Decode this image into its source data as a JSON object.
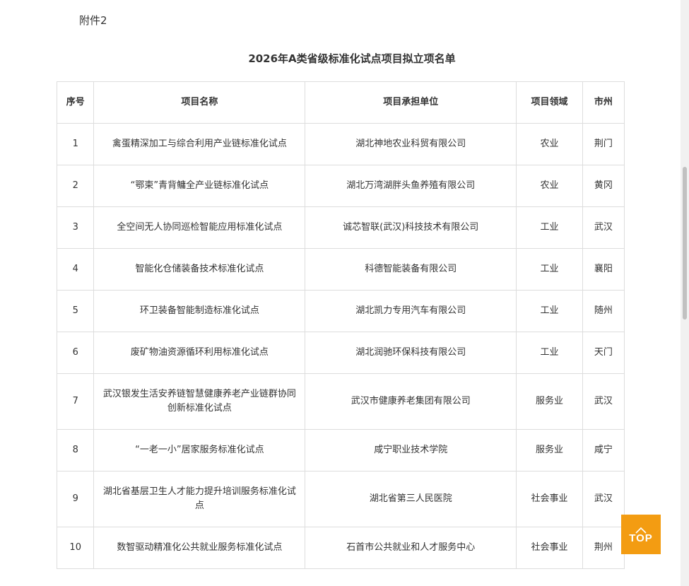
{
  "document": {
    "attachment_label": "附件2",
    "title": "2026年A类省级标准化试点项目拟立项名单"
  },
  "table": {
    "headers": {
      "seq": "序号",
      "name": "项目名称",
      "unit": "项目承担单位",
      "field": "项目领域",
      "city": "市州"
    },
    "rows": [
      {
        "seq": "1",
        "name": "禽蛋精深加工与综合利用产业链标准化试点",
        "unit": "湖北神地农业科贸有限公司",
        "field": "农业",
        "city": "荆门"
      },
      {
        "seq": "2",
        "name": "“鄂柬”青背鳙全产业链标准化试点",
        "unit": "湖北万湾湖胖头鱼养殖有限公司",
        "field": "农业",
        "city": "黄冈"
      },
      {
        "seq": "3",
        "name": "全空间无人协同巡检智能应用标准化试点",
        "unit": "诚芯智联(武汉)科技技术有限公司",
        "field": "工业",
        "city": "武汉"
      },
      {
        "seq": "4",
        "name": "智能化仓储装备技术标准化试点",
        "unit": "科德智能装备有限公司",
        "field": "工业",
        "city": "襄阳"
      },
      {
        "seq": "5",
        "name": "环卫装备智能制造标准化试点",
        "unit": "湖北凯力专用汽车有限公司",
        "field": "工业",
        "city": "随州"
      },
      {
        "seq": "6",
        "name": "废矿物油资源循环利用标准化试点",
        "unit": "湖北润驰环保科技有限公司",
        "field": "工业",
        "city": "天门"
      },
      {
        "seq": "7",
        "name": "武汉银发生活安养链智慧健康养老产业链群协同创新标准化试点",
        "unit": "武汉市健康养老集团有限公司",
        "field": "服务业",
        "city": "武汉"
      },
      {
        "seq": "8",
        "name": "“一老一小”居家服务标准化试点",
        "unit": "咸宁职业技术学院",
        "field": "服务业",
        "city": "咸宁"
      },
      {
        "seq": "9",
        "name": "湖北省基层卫生人才能力提升培训服务标准化试点",
        "unit": "湖北省第三人民医院",
        "field": "社会事业",
        "city": "武汉"
      },
      {
        "seq": "10",
        "name": "数智驱动精准化公共就业服务标准化试点",
        "unit": "石首市公共就业和人才服务中心",
        "field": "社会事业",
        "city": "荆州"
      }
    ]
  },
  "top_button": {
    "label": "TOP",
    "icon": "chevron-up-icon",
    "color": "#f39c12"
  }
}
